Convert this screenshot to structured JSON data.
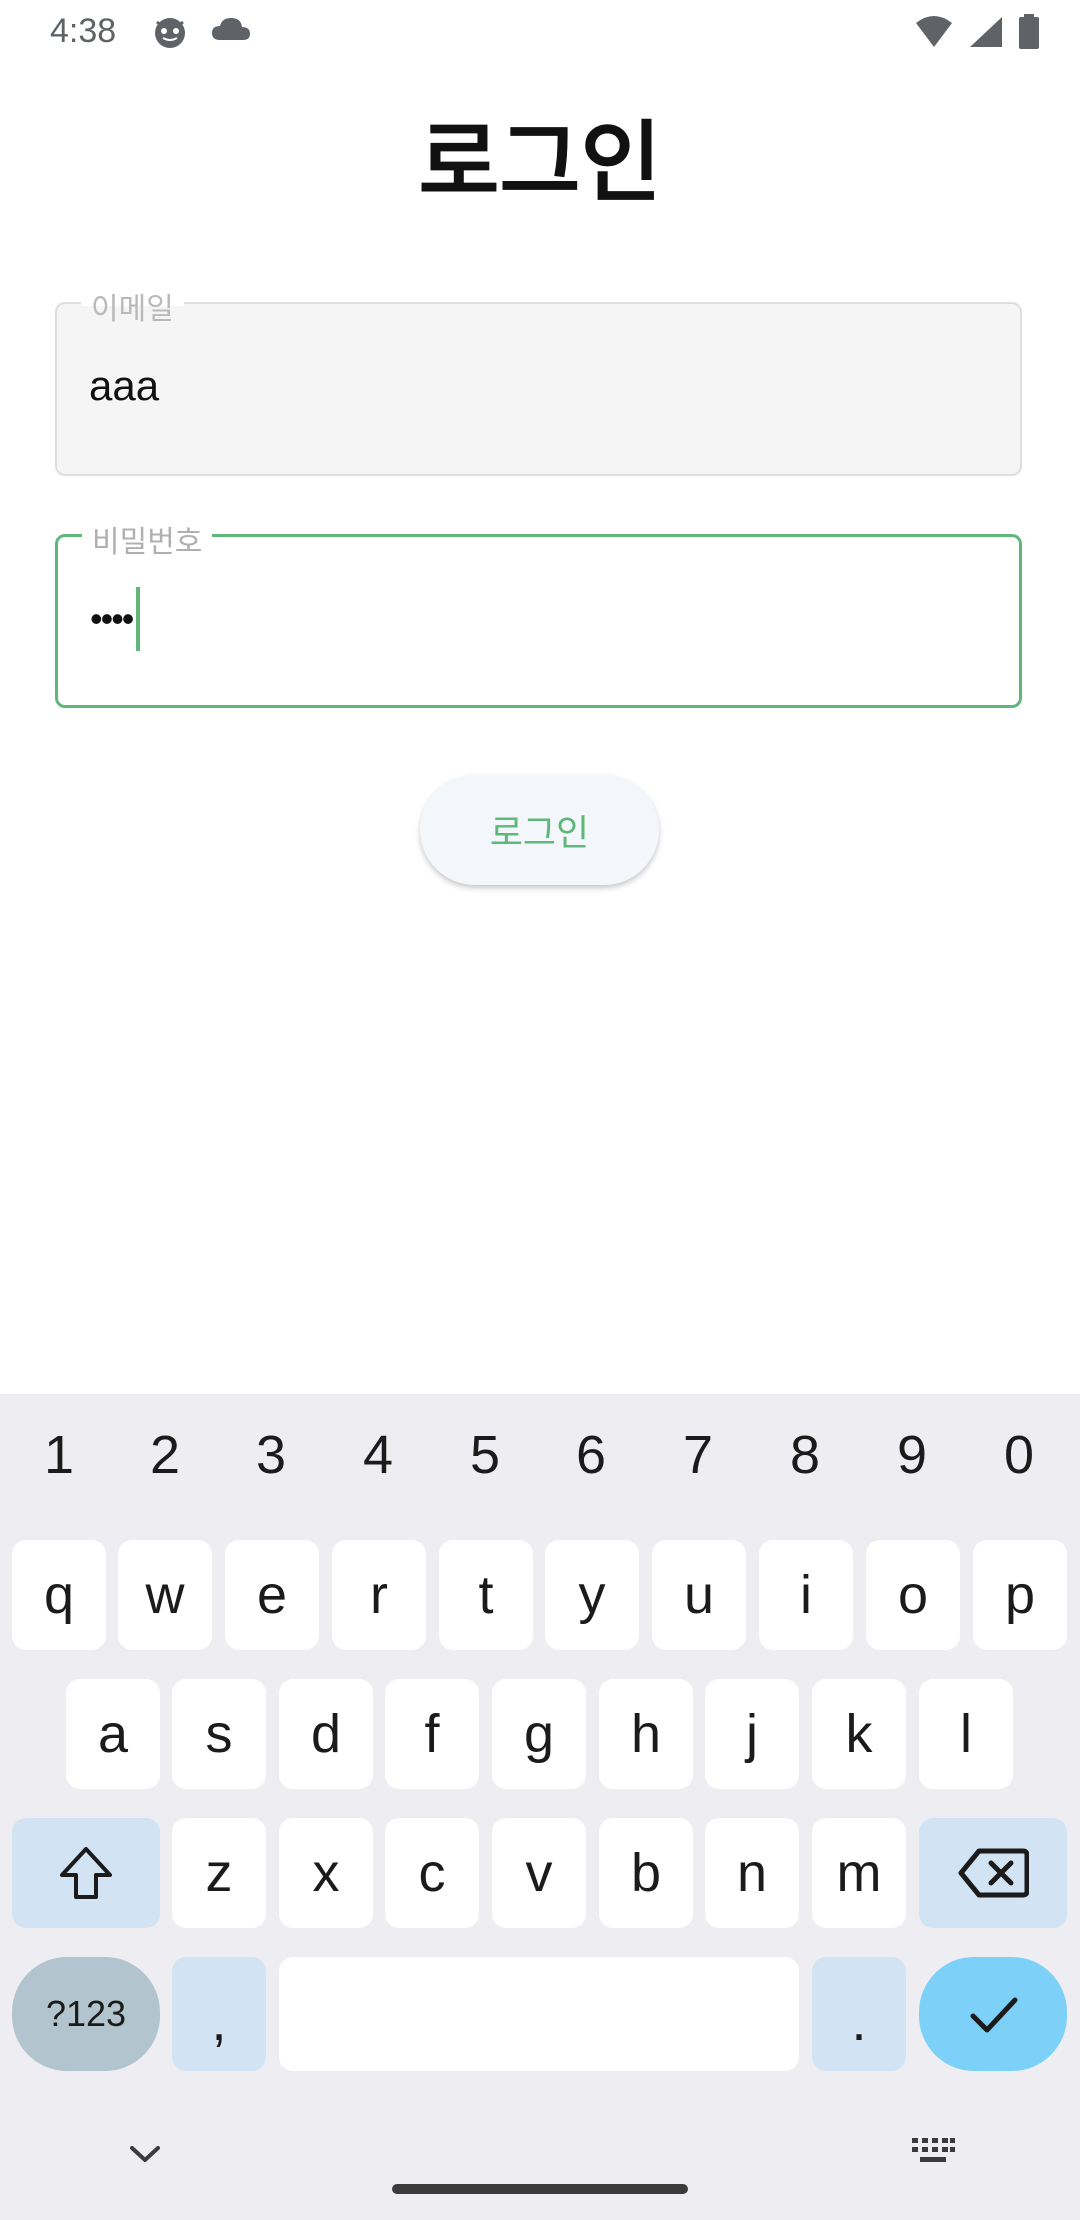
{
  "status_bar": {
    "time": "4:38"
  },
  "page": {
    "title": "로그인"
  },
  "email_field": {
    "label": "이메일",
    "value": "aaa"
  },
  "password_field": {
    "label": "비밀번호",
    "value": "••••"
  },
  "login_button": {
    "label": "로그인"
  },
  "keyboard": {
    "numbers": [
      "1",
      "2",
      "3",
      "4",
      "5",
      "6",
      "7",
      "8",
      "9",
      "0"
    ],
    "row1": [
      "q",
      "w",
      "e",
      "r",
      "t",
      "y",
      "u",
      "i",
      "o",
      "p"
    ],
    "row2": [
      "a",
      "s",
      "d",
      "f",
      "g",
      "h",
      "j",
      "k",
      "l"
    ],
    "row3": [
      "z",
      "x",
      "c",
      "v",
      "b",
      "n",
      "m"
    ],
    "symbols_label": "?123",
    "comma_label": ",",
    "period_label": "."
  },
  "colors": {
    "accent": "#5fb87a",
    "enter_key": "#7dd0f7",
    "modifier_key": "#d2e3f3"
  }
}
